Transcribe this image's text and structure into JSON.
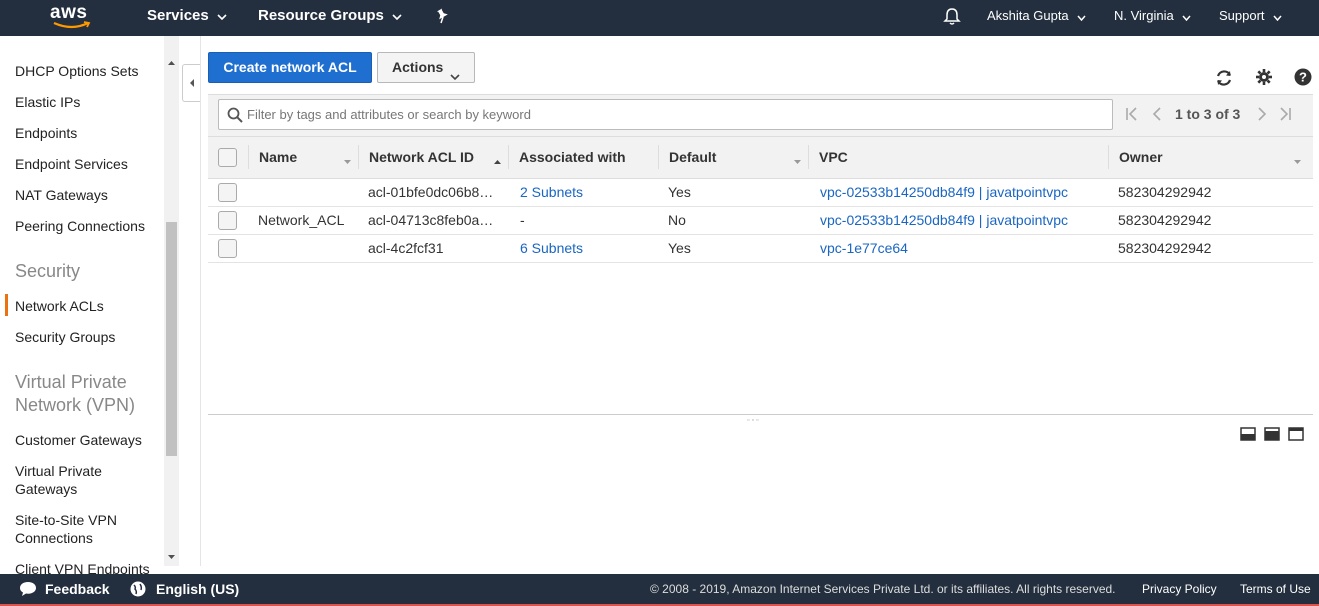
{
  "topnav": {
    "logo_text": "aws",
    "services": "Services",
    "resource_groups": "Resource Groups",
    "user": "Akshita Gupta",
    "region": "N. Virginia",
    "support": "Support"
  },
  "sidebar": {
    "items_top": [
      "DHCP Options Sets",
      "Elastic IPs",
      "Endpoints",
      "Endpoint Services",
      "NAT Gateways",
      "Peering Connections"
    ],
    "section_security": "Security",
    "security_items": [
      "Network ACLs",
      "Security Groups"
    ],
    "active_item": "Network ACLs",
    "section_vpn_line1": "Virtual Private",
    "section_vpn_line2": "Network (VPN)",
    "vpn_items": [
      {
        "line1": "Customer Gateways",
        "line2": ""
      },
      {
        "line1": "Virtual Private",
        "line2": "Gateways"
      },
      {
        "line1": "Site-to-Site VPN",
        "line2": "Connections"
      },
      {
        "line1": "Client VPN Endpoints",
        "line2": ""
      }
    ]
  },
  "toolbar": {
    "create_label": "Create network ACL",
    "actions_label": "Actions"
  },
  "search": {
    "placeholder": "Filter by tags and attributes or search by keyword",
    "value": ""
  },
  "pager": {
    "text": "1 to 3 of 3"
  },
  "table": {
    "columns": [
      "Name",
      "Network ACL ID",
      "Associated with",
      "Default",
      "VPC",
      "Owner"
    ],
    "rows": [
      {
        "name": "",
        "acl_id": "acl-01bfe0dc06b8…",
        "associated": "2 Subnets",
        "default": "Yes",
        "vpc": "vpc-02533b14250db84f9 | javatpointvpc",
        "owner": "582304292942"
      },
      {
        "name": "Network_ACL",
        "acl_id": "acl-04713c8feb0a…",
        "associated": "-",
        "default": "No",
        "vpc": "vpc-02533b14250db84f9 | javatpointvpc",
        "owner": "582304292942"
      },
      {
        "name": "",
        "acl_id": "acl-4c2fcf31",
        "associated": "6 Subnets",
        "default": "Yes",
        "vpc": "vpc-1e77ce64",
        "owner": "582304292942"
      }
    ]
  },
  "footer": {
    "feedback": "Feedback",
    "language": "English (US)",
    "copyright": "© 2008 - 2019, Amazon Internet Services Private Ltd. or its affiliates. All rights reserved.",
    "privacy": "Privacy Policy",
    "terms": "Terms of Use"
  },
  "colors": {
    "nav_bg": "#232f3e",
    "primary_button": "#1f6fd0",
    "active_accent": "#ec7211",
    "link": "#1a66c2"
  },
  "icons": [
    "pin-icon",
    "bell-icon",
    "refresh-icon",
    "gear-icon",
    "help-icon",
    "search-icon",
    "speech-bubble-icon",
    "globe-icon"
  ]
}
